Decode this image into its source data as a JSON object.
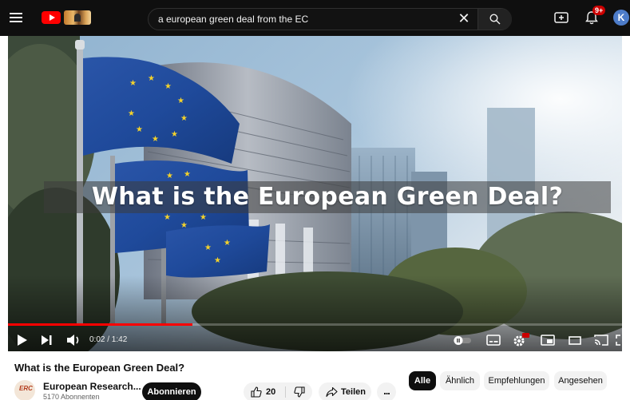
{
  "colors": {
    "accent": "#ff0000",
    "topbar_bg": "#0f0f0f",
    "avatar_bg": "#4d7cc9",
    "notification_badge": "#cc0000"
  },
  "topbar": {
    "menu_icon": "hamburger-menu-icon",
    "logo_icon": "youtube-logo-icon",
    "search": {
      "value": "a european green deal from the EC",
      "clear_icon": "close-icon",
      "search_icon": "search-icon"
    },
    "create_icon": "create-video-icon",
    "notification_icon": "bell-icon",
    "notification_badge": "9+",
    "avatar_letter": "K"
  },
  "player": {
    "overlay_title": "What is the European Green Deal?",
    "time_display": "0:02 / 1:42",
    "progress_fraction": 0.3,
    "controls": {
      "play_icon": "play-icon",
      "next_icon": "next-icon",
      "volume_icon": "volume-icon",
      "autoplay_icon": "autoplay-toggle-icon",
      "subtitles_icon": "subtitles-icon",
      "settings_icon": "gear-icon",
      "settings_badge": "HD",
      "miniplayer_icon": "miniplayer-icon",
      "theater_icon": "theater-mode-icon",
      "cast_icon": "cast-icon",
      "fullscreen_icon": "fullscreen-icon"
    }
  },
  "video": {
    "title": "What is the European Green Deal?",
    "channel": {
      "name": "European Research...",
      "subscribers": "5170 Abonnenten",
      "subscribe_label": "Abonnieren"
    },
    "actions": {
      "like_count": "20",
      "share_label": "Teilen",
      "more_label": "..."
    }
  },
  "chips": [
    {
      "label": "Alle",
      "active": true
    },
    {
      "label": "Ähnlich",
      "active": false
    },
    {
      "label": "Empfehlungen",
      "active": false
    },
    {
      "label": "Angesehen",
      "active": false
    }
  ]
}
